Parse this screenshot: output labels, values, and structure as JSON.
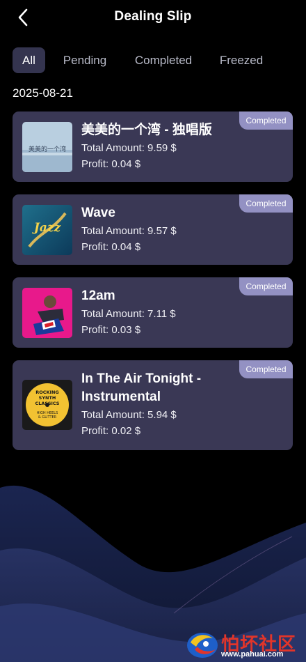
{
  "header": {
    "title": "Dealing Slip"
  },
  "tabs": [
    {
      "label": "All",
      "active": true
    },
    {
      "label": "Pending",
      "active": false
    },
    {
      "label": "Completed",
      "active": false
    },
    {
      "label": "Freezed",
      "active": false
    }
  ],
  "date": "2025-08-21",
  "orders": [
    {
      "title": "美美的一个湾 - 独唱版",
      "total": "Total Amount:  9.59 $",
      "profit": "Profit:  0.04 $",
      "status": "Completed",
      "cover_text": "美美的一个湾"
    },
    {
      "title": "Wave",
      "total": "Total Amount:  9.57 $",
      "profit": "Profit:  0.04 $",
      "status": "Completed",
      "cover_text": "Jazz"
    },
    {
      "title": "12am",
      "total": "Total Amount:  7.11 $",
      "profit": "Profit:  0.03 $",
      "status": "Completed",
      "cover_text": ""
    },
    {
      "title": "In The Air Tonight - Instrumental",
      "total": "Total Amount:  5.94 $",
      "profit": "Profit:  0.02 $",
      "status": "Completed",
      "cover_text": "ROCKING SYNTH CLASSICS",
      "cover_subtext": "HIGH HEELS & GLITTER"
    }
  ],
  "watermark": {
    "text": "怕坏社区",
    "url": "www.pahuai.com"
  },
  "colors": {
    "card": "#3a3855",
    "badge": "#9391c3",
    "tab_active": "#34344f",
    "background": "#000000"
  }
}
